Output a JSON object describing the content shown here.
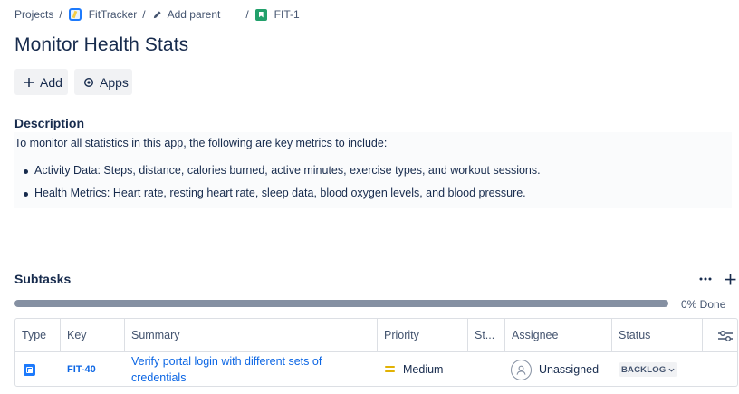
{
  "breadcrumb": {
    "projects": "Projects",
    "separator": "/",
    "project": "FitTracker",
    "add_parent": "Add parent",
    "issue_key": "FIT-1"
  },
  "page_title": "Monitor Health Stats",
  "actions": {
    "add_label": "Add",
    "apps_label": "Apps"
  },
  "description": {
    "heading": "Description",
    "intro": "To monitor all statistics in this app, the following are key metrics to include:",
    "bullets": [
      "Activity Data: Steps, distance, calories burned, active minutes, exercise types, and workout sessions.",
      "Health Metrics: Heart rate, resting heart rate, sleep data, blood oxygen levels, and blood pressure."
    ]
  },
  "subtasks": {
    "heading": "Subtasks",
    "progress_percent": 0,
    "progress_label": "0% Done",
    "columns": [
      "Type",
      "Key",
      "Summary",
      "Priority",
      "St...",
      "Assignee",
      "Status"
    ],
    "rows": [
      {
        "type": "subtask",
        "key": "FIT-40",
        "summary": "Verify portal login with different sets of credentials",
        "priority": "Medium",
        "assignee": "Unassigned",
        "status": "BACKLOG"
      }
    ]
  },
  "colors": {
    "link": "#0c66e4",
    "text": "#172b4d",
    "subtle_text": "#44546f",
    "progress_track": "#8590a2",
    "priority_medium": "#e2b203",
    "story_green": "#22a06b",
    "subtask_blue": "#1d7afc"
  },
  "icons": [
    "project-icon",
    "pencil-icon",
    "story-icon",
    "plus-icon",
    "apps-icon",
    "more-icon",
    "subtask-icon",
    "priority-medium-icon",
    "avatar-icon",
    "chevron-down-icon",
    "settings-icon"
  ]
}
